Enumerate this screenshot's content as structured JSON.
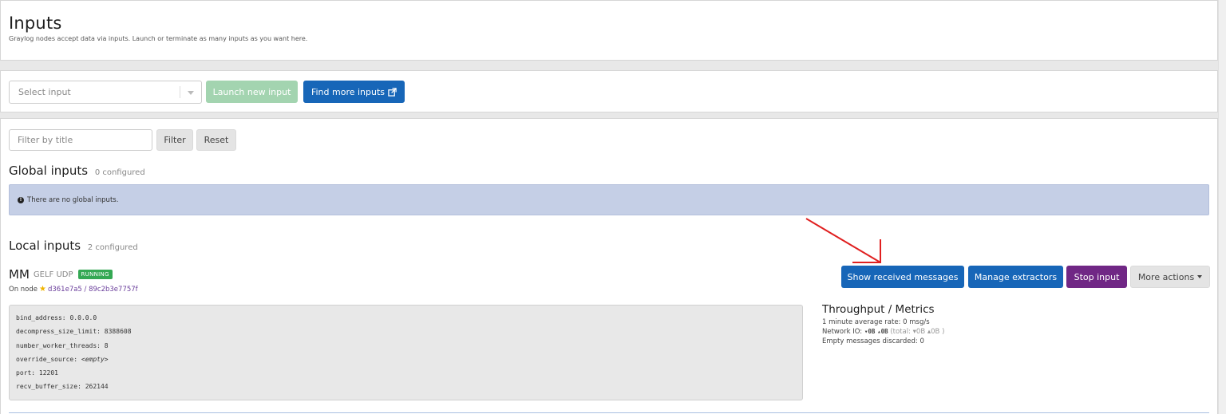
{
  "header": {
    "title": "Inputs",
    "subtitle": "Graylog nodes accept data via inputs. Launch or terminate as many inputs as you want here."
  },
  "launch_bar": {
    "select_placeholder": "Select input",
    "launch_label": "Launch new input",
    "find_more_label": "Find more inputs"
  },
  "filter_bar": {
    "placeholder": "Filter by title",
    "filter_label": "Filter",
    "reset_label": "Reset"
  },
  "global_inputs": {
    "title": "Global inputs",
    "count": "0 configured",
    "empty_message": "There are no global inputs."
  },
  "local_inputs": {
    "title": "Local inputs",
    "count": "2 configured",
    "inputs": [
      {
        "name": "MM",
        "type": "GELF UDP",
        "status": "RUNNING",
        "node_prefix": "On node",
        "node_id": "d361e7a5 / 89c2b3e7757f",
        "actions": {
          "show_messages": "Show received messages",
          "manage_extractors": "Manage extractors",
          "stop": "Stop input",
          "more": "More actions"
        },
        "config": [
          {
            "key": "bind_address",
            "value": "0.0.0.0"
          },
          {
            "key": "decompress_size_limit",
            "value": "8388608"
          },
          {
            "key": "number_worker_threads",
            "value": "8"
          },
          {
            "key": "override_source",
            "value": "<empty>"
          },
          {
            "key": "port",
            "value": "12201"
          },
          {
            "key": "recv_buffer_size",
            "value": "262144"
          }
        ],
        "metrics": {
          "title": "Throughput / Metrics",
          "avg_rate": "1 minute average rate: 0 msg/s",
          "network_label": "Network IO:",
          "network_in": "0B",
          "network_out": "0B",
          "total_prefix": "(total:",
          "total_in": "0B",
          "total_out": "0B",
          "total_suffix": ")",
          "empty_discarded": "Empty messages discarded: 0"
        }
      }
    ]
  },
  "colors": {
    "primary": "#1766b8",
    "success_light": "#a3d4b0",
    "stop": "#702785",
    "running_badge": "#34a853",
    "alert_bg": "#c5cfe6",
    "annotation_arrow": "#e02020"
  }
}
